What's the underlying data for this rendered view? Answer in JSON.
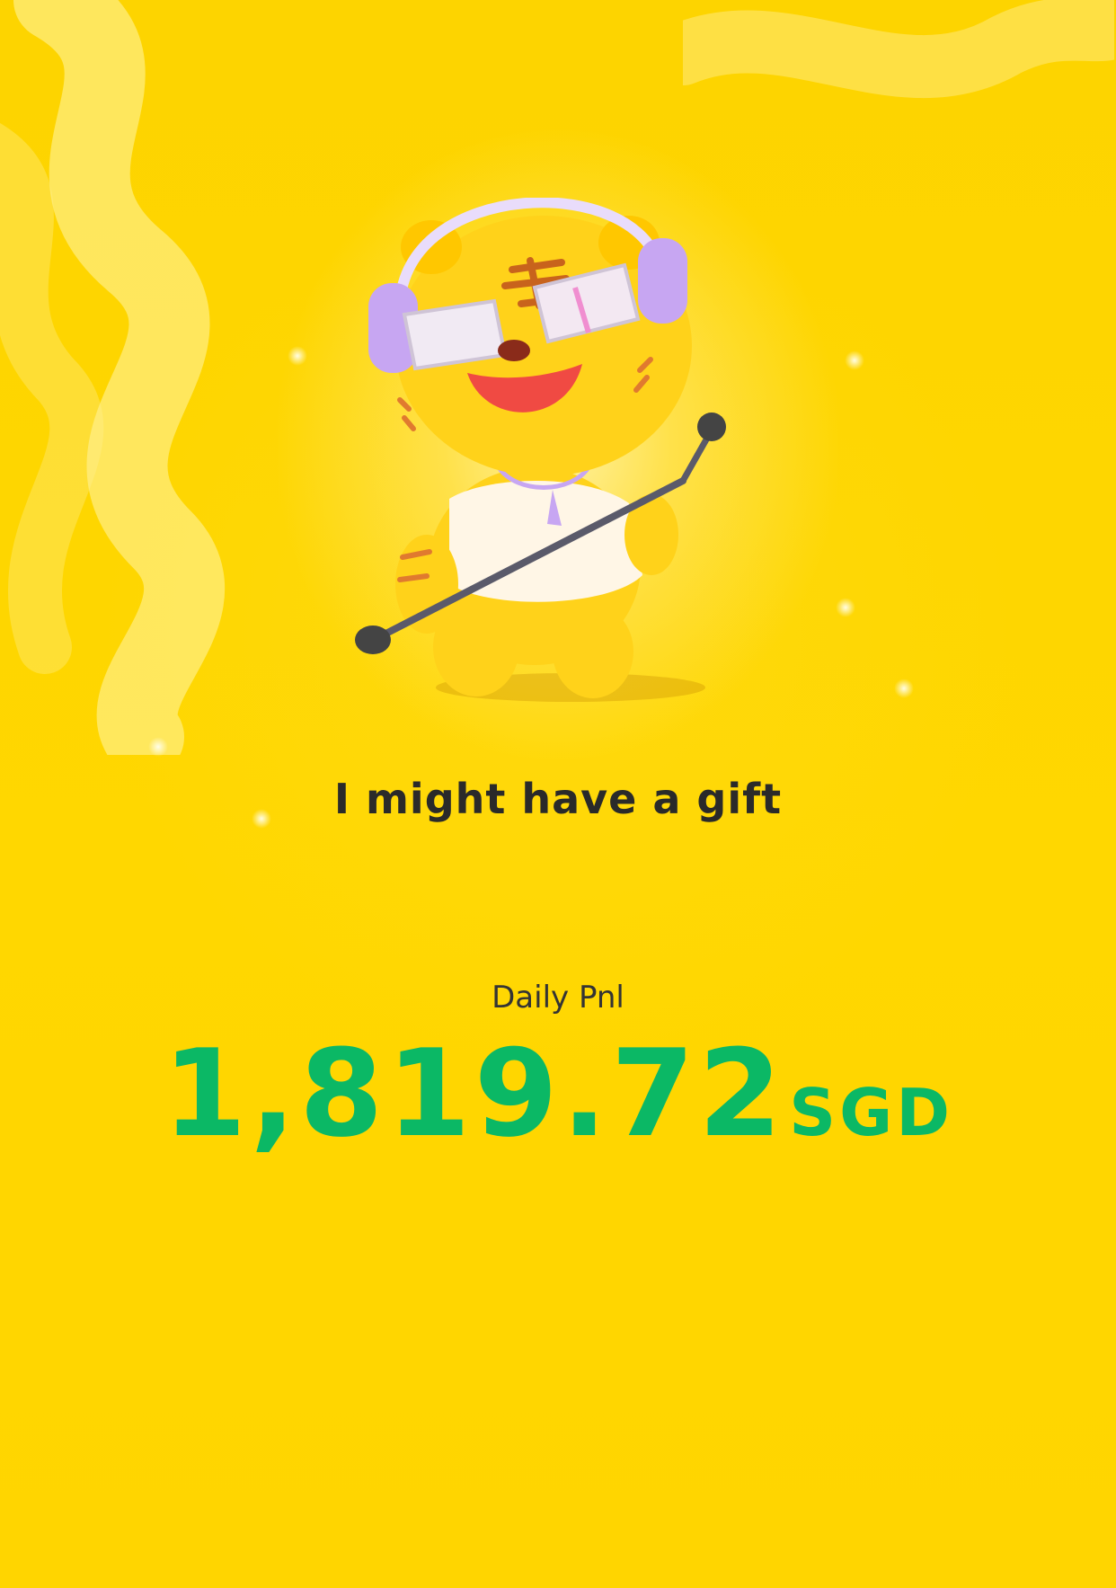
{
  "mascot": {
    "icon": "tiger-singer-icon",
    "description_colors": {
      "body": "#ffd21a",
      "headphones": "#c7a6f2",
      "shirt": "#fff7ea",
      "mouth": "#f04a43",
      "stripes": "#e07a2f"
    }
  },
  "headline": "I might have a gift",
  "pnl": {
    "label": "Daily Pnl",
    "amount": "1,819.72",
    "currency": "SGD",
    "color": "#0bb865"
  },
  "colors": {
    "background": "#ffd600",
    "text_dark": "#2a2a2a"
  }
}
